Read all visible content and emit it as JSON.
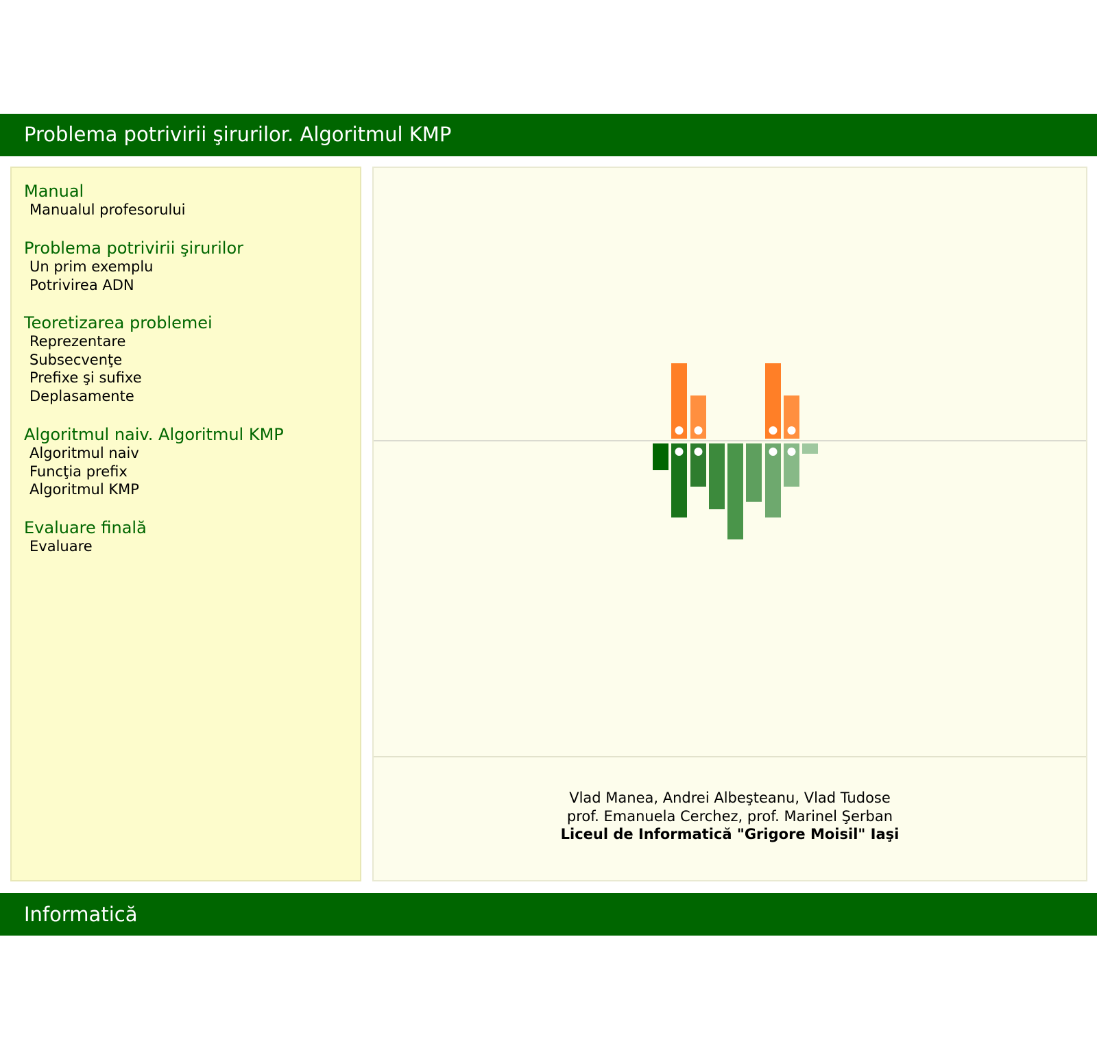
{
  "header": {
    "title": "Problema potrivirii şirurilor. Algoritmul KMP"
  },
  "sidebar": {
    "sections": [
      {
        "title": "Manual",
        "items": [
          "Manualul profesorului"
        ]
      },
      {
        "title": "Problema potrivirii şirurilor",
        "items": [
          "Un prim exemplu",
          "Potrivirea ADN"
        ]
      },
      {
        "title": "Teoretizarea problemei",
        "items": [
          "Reprezentare",
          "Subsecvenţe",
          "Prefixe şi sufixe",
          "Deplasamente"
        ]
      },
      {
        "title": "Algoritmul naiv. Algoritmul KMP",
        "items": [
          "Algoritmul naiv",
          "Funcţia prefix",
          "Algoritmul KMP"
        ]
      },
      {
        "title": "Evaluare finală",
        "items": [
          "Evaluare"
        ]
      }
    ]
  },
  "main": {
    "credits": {
      "authors": "Vlad Manea, Andrei Albeşteanu, Vlad Tudose",
      "teachers": "prof. Emanuela Cerchez, prof. Marinel Şerban",
      "school": "Liceul de Informatică \"Grigore Moisil\" Iaşi"
    },
    "logo": {
      "upper_color": "#ff7f27",
      "upper_light_color": "#ff8f3f",
      "lower_colors": [
        "#006600",
        "#1a741a",
        "#2e7d2e",
        "#3c8a3c",
        "#4a954a",
        "#5e9f5e",
        "#6ea96e",
        "#87b987",
        "#9fc89f"
      ]
    }
  },
  "footer": {
    "title": "Informatică"
  }
}
